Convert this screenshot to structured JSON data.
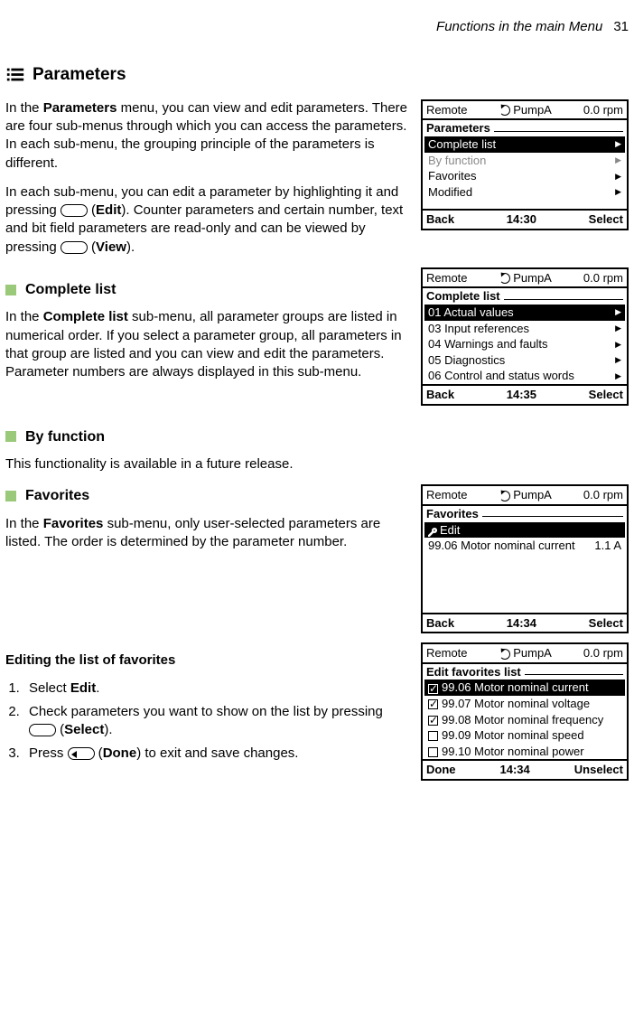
{
  "header": {
    "chapter": "Functions in the main Menu",
    "page": "31"
  },
  "title": "Parameters",
  "intro1_a": "In the ",
  "intro1_b": "Parameters",
  "intro1_c": " menu, you can view and edit parameters. There are four sub-menus through which you can access the parameters. In each sub-menu, the grouping principle of the parameters is different.",
  "intro2_a": "In each sub-menu, you can edit a parameter by highlighting it and pressing ",
  "intro2_b": " (",
  "intro2_c": "Edit",
  "intro2_d": "). Counter parameters and certain number, text and bit field parameters are read-only and can be viewed by pressing ",
  "intro2_e": " (",
  "intro2_f": "View",
  "intro2_g": ").",
  "screens": {
    "parameters": {
      "top_l": "Remote",
      "top_m": "PumpA",
      "top_r": "0.0 rpm",
      "title": "Parameters",
      "rows": [
        "Complete list",
        "By function",
        "Favorites",
        "Modified"
      ],
      "selected": 0,
      "greyed": 1,
      "foot_l": "Back",
      "foot_m": "14:30",
      "foot_r": "Select"
    },
    "complete": {
      "top_l": "Remote",
      "top_m": "PumpA",
      "top_r": "0.0 rpm",
      "title": "Complete list",
      "rows": [
        "01 Actual values",
        "03 Input references",
        "04 Warnings and faults",
        "05 Diagnostics",
        "06 Control and status words"
      ],
      "selected": 0,
      "foot_l": "Back",
      "foot_m": "14:35",
      "foot_r": "Select"
    },
    "favorites": {
      "top_l": "Remote",
      "top_m": "PumpA",
      "top_r": "0.0 rpm",
      "title": "Favorites",
      "edit_row": "Edit",
      "rows": [
        {
          "l": "99.06 Motor nominal current",
          "r": "1.1 A"
        }
      ],
      "foot_l": "Back",
      "foot_m": "14:34",
      "foot_r": "Select"
    },
    "editfav": {
      "top_l": "Remote",
      "top_m": "PumpA",
      "top_r": "0.0 rpm",
      "title": "Edit favorites list",
      "rows": [
        {
          "c": true,
          "t": "99.06 Motor nominal current"
        },
        {
          "c": true,
          "t": "99.07 Motor nominal voltage"
        },
        {
          "c": true,
          "t": "99.08 Motor nominal frequency"
        },
        {
          "c": false,
          "t": "99.09 Motor nominal speed"
        },
        {
          "c": false,
          "t": "99.10 Motor nominal power"
        }
      ],
      "selected": 0,
      "foot_l": "Done",
      "foot_m": "14:34",
      "foot_r": "Unselect"
    }
  },
  "complete_h": "Complete list",
  "complete_p_a": "In the ",
  "complete_p_b": "Complete list",
  "complete_p_c": " sub-menu, all parameter groups are listed in numerical order. If you select a parameter group, all parameters in that group are listed and you can view and edit the parameters. Parameter numbers are always displayed in this sub-menu.",
  "byfunc_h": "By function",
  "byfunc_p": "This functionality is available in a future release.",
  "fav_h": "Favorites",
  "fav_p_a": "In the ",
  "fav_p_b": "Favorites",
  "fav_p_c": " sub-menu, only user-selected parameters are listed. The order is determined by the parameter number.",
  "editfav_h": "Editing the list of favorites",
  "steps": {
    "s1_a": "Select ",
    "s1_b": "Edit",
    "s1_c": ".",
    "s2_a": "Check parameters you want to show on the list by pressing ",
    "s2_b": " (",
    "s2_c": "Select",
    "s2_d": ").",
    "s3_a": "Press ",
    "s3_b": " (",
    "s3_c": "Done",
    "s3_d": ") to exit and save changes."
  }
}
